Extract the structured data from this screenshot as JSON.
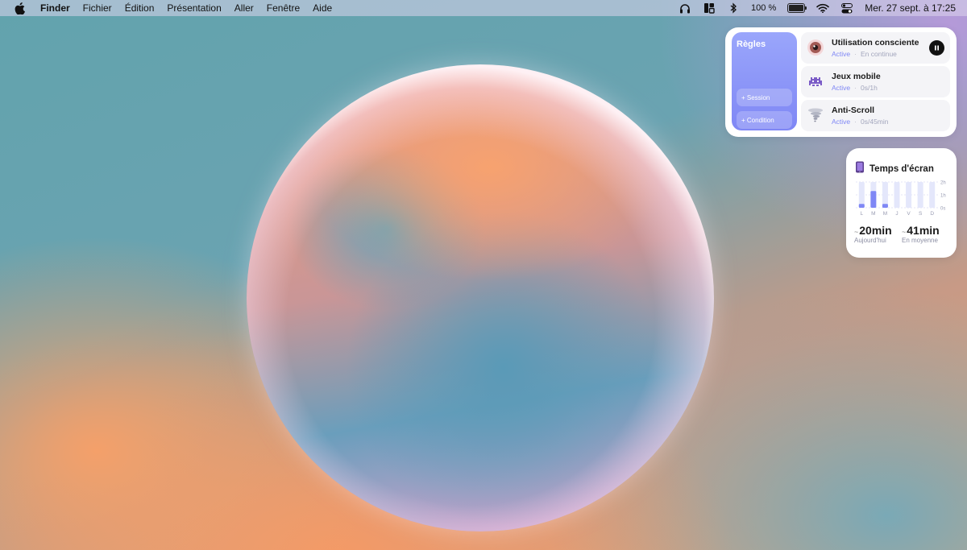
{
  "menubar": {
    "app_name": "Finder",
    "items": [
      "Fichier",
      "Édition",
      "Présentation",
      "Aller",
      "Fenêtre",
      "Aide"
    ],
    "battery_text": "100 %",
    "battery_level": 1.0,
    "clock": "Mer. 27 sept. à 17:25",
    "status_icons": [
      "headphones-icon",
      "stage-manager-icon",
      "bluetooth-icon",
      "battery-icon",
      "wifi-icon",
      "control-center-icon"
    ]
  },
  "rules_widget": {
    "title": "Règles",
    "session_button": "+ Session",
    "condition_button": "+ Condition",
    "rules": [
      {
        "title": "Utilisation consciente",
        "status": "Active",
        "detail": "En continue",
        "icon": "eye-icon"
      },
      {
        "title": "Jeux mobile",
        "status": "Active",
        "detail": "0s/1h",
        "icon": "space-invader-icon"
      },
      {
        "title": "Anti-Scroll",
        "status": "Active",
        "detail": "0s/45min",
        "icon": "tornado-icon"
      }
    ]
  },
  "screen_time": {
    "title": "Temps d'écran",
    "today_value": "20min",
    "today_label": "Aujourd'hui",
    "average_value": "41min",
    "average_label": "En moyenne",
    "tilde": "~",
    "chart_data": {
      "type": "bar",
      "categories": [
        "L",
        "M",
        "M",
        "J",
        "V",
        "S",
        "D"
      ],
      "values": [
        0.3,
        1.3,
        0.3,
        0,
        0,
        0,
        0
      ],
      "y_ticks": [
        "2h",
        "1h",
        "0s"
      ],
      "ylim": [
        0,
        2
      ],
      "unit": "h"
    }
  },
  "colors": {
    "accent": "#7f87f5",
    "bar": "#7f87f5",
    "bar_track": "#e4e7fb"
  }
}
